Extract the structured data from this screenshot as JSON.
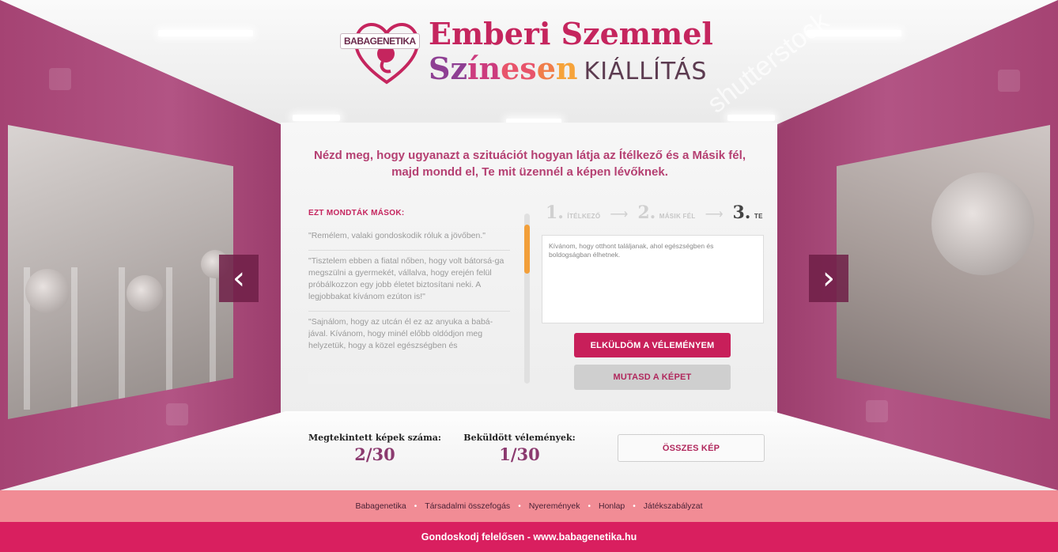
{
  "logo": {
    "brand": "BABAGENETIKA",
    "line1": "Emberi Szemmel",
    "line2_parts": [
      "Sz",
      "ín",
      "es",
      "e",
      "n"
    ],
    "line2_suffix": "KIÁLLÍTÁS"
  },
  "watermark": "shutterstock",
  "headline": {
    "line1": "Nézd meg, hogy ugyanazt a szituációt hogyan látja az Ítélkező és a Másik fél,",
    "line2": "majd mondd el, Te mit üzennél a képen lévőknek."
  },
  "others": {
    "title": "EZT MONDTÁK MÁSOK:",
    "opinions": [
      "\"Remélem, valaki gondoskodik róluk a jövőben.\"",
      "\"Tisztelem ebben a fiatal nőben, hogy volt bátorsá-ga megszülni a gyermekét, vállalva, hogy erején felül próbálkozzon egy jobb életet biztosítani neki. A legjobbakat kívánom ezúton is!\"",
      "\"Sajnálom, hogy az utcán él ez az anyuka a babá-jával. Kívánom, hogy minél előbb oldódjon meg helyzetük, hogy a közel egészségben és"
    ]
  },
  "steps": [
    {
      "num": "1.",
      "label": "ÍTÉLKEZŐ"
    },
    {
      "num": "2.",
      "label": "MÁSIK FÉL"
    },
    {
      "num": "3.",
      "label": "TE"
    }
  ],
  "step_arrow": "⟶",
  "opinion_input": {
    "value": "Kívánom, hogy otthont találjanak, ahol egészségben és boldogságban élhetnek."
  },
  "buttons": {
    "send": "ELKÜLDÖM A VÉLEMÉNYEM",
    "show": "MUTASD A KÉPET",
    "all": "ÖSSZES KÉP"
  },
  "stats": {
    "views_label": "Megtekintett képek száma:",
    "views_value": "2/30",
    "opinions_label": "Beküldött vélemények:",
    "opinions_value": "1/30"
  },
  "nav": {
    "prev": "‹",
    "next": "›"
  },
  "footer": {
    "links": [
      "Babagenetika",
      "Társadalmi összefogás",
      "Nyeremények",
      "Honlap",
      "Játékszabályzat"
    ],
    "separator": "•",
    "tagline": "Gondoskodj felelősen - www.babagenetika.hu"
  },
  "colors": {
    "accent": "#c81f5a",
    "wall": "#a54373",
    "footer_nav": "#f18c95",
    "footer_main": "#d91f5f",
    "scroll_thumb": "#f29f3a"
  }
}
